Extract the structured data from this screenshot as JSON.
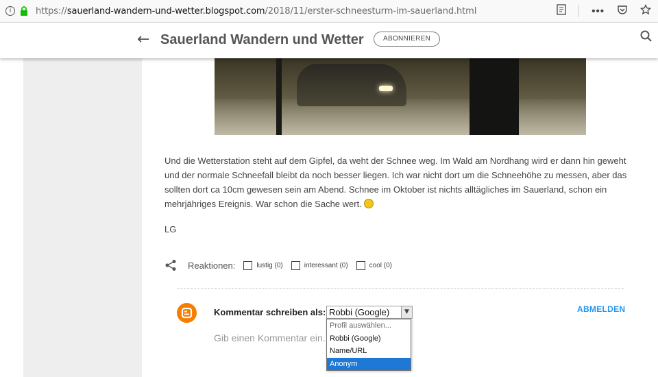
{
  "browser": {
    "url_prefix": "https://",
    "url_host": "sauerland-wandern-und-wetter.blogspot.com",
    "url_path": "/2018/11/erster-schneesturm-im-sauerland.html"
  },
  "header": {
    "blog_title": "Sauerland Wandern und Wetter",
    "subscribe_label": "ABONNIEREN"
  },
  "post": {
    "paragraph": "Und die Wetterstation steht auf dem Gipfel, da weht der Schnee weg. Im Wald am Nordhang wird er dann hin geweht und der normale Schneefall bleibt da noch besser liegen. Ich war nicht dort um die Schneehöhe zu messen, aber das sollten dort ca 10cm gewesen sein am Abend. Schnee im Oktober ist nichts alltägliches im Sauerland, schon ein mehrjähriges Ereignis. War schon die Sache wert.",
    "signoff": "LG"
  },
  "reactions": {
    "label": "Reaktionen:",
    "items": [
      {
        "label": "lustig (0)"
      },
      {
        "label": "interessant (0)"
      },
      {
        "label": "cool (0)"
      }
    ]
  },
  "comments": {
    "comment_as_label": "Kommentar schreiben als:",
    "selected_profile": "Robbi (Google)",
    "logout_label": "ABMELDEN",
    "placeholder": "Gib einen Kommentar ein...",
    "dropdown_options": [
      {
        "label": "Profil auswählen..."
      },
      {
        "label": "Robbi (Google)"
      },
      {
        "label": "Name/URL"
      },
      {
        "label": "Anonym"
      }
    ]
  },
  "colors": {
    "accent": "#2196f3",
    "blogger_orange": "#f57d00",
    "dropdown_highlight": "#1e78d6"
  }
}
